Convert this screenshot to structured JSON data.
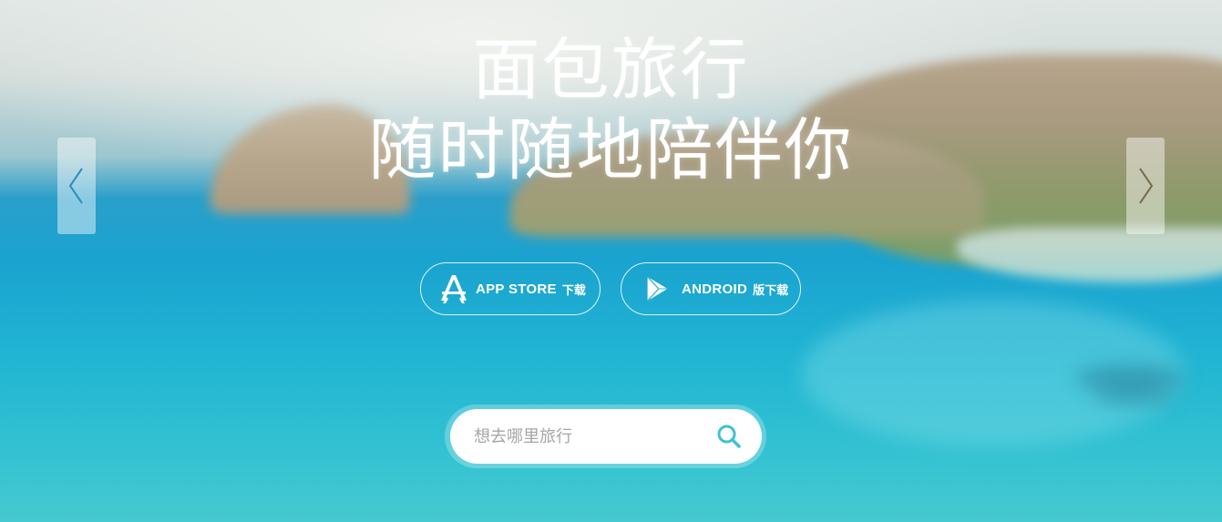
{
  "hero": {
    "title_line1": "面包旅行",
    "title_line2": "随时随地陪伴你",
    "prev_icon": "chevron-left-icon",
    "next_icon": "chevron-right-icon"
  },
  "downloads": {
    "appstore": {
      "label": "APP STORE",
      "sub": "下载",
      "icon": "app-store-icon"
    },
    "android": {
      "label": "ANDROID",
      "sub": "版下载",
      "icon": "google-play-icon"
    }
  },
  "search": {
    "placeholder": "想去哪里旅行",
    "icon": "search-icon"
  },
  "colors": {
    "accent": "#3fc1d6",
    "text": "#ffffff"
  }
}
